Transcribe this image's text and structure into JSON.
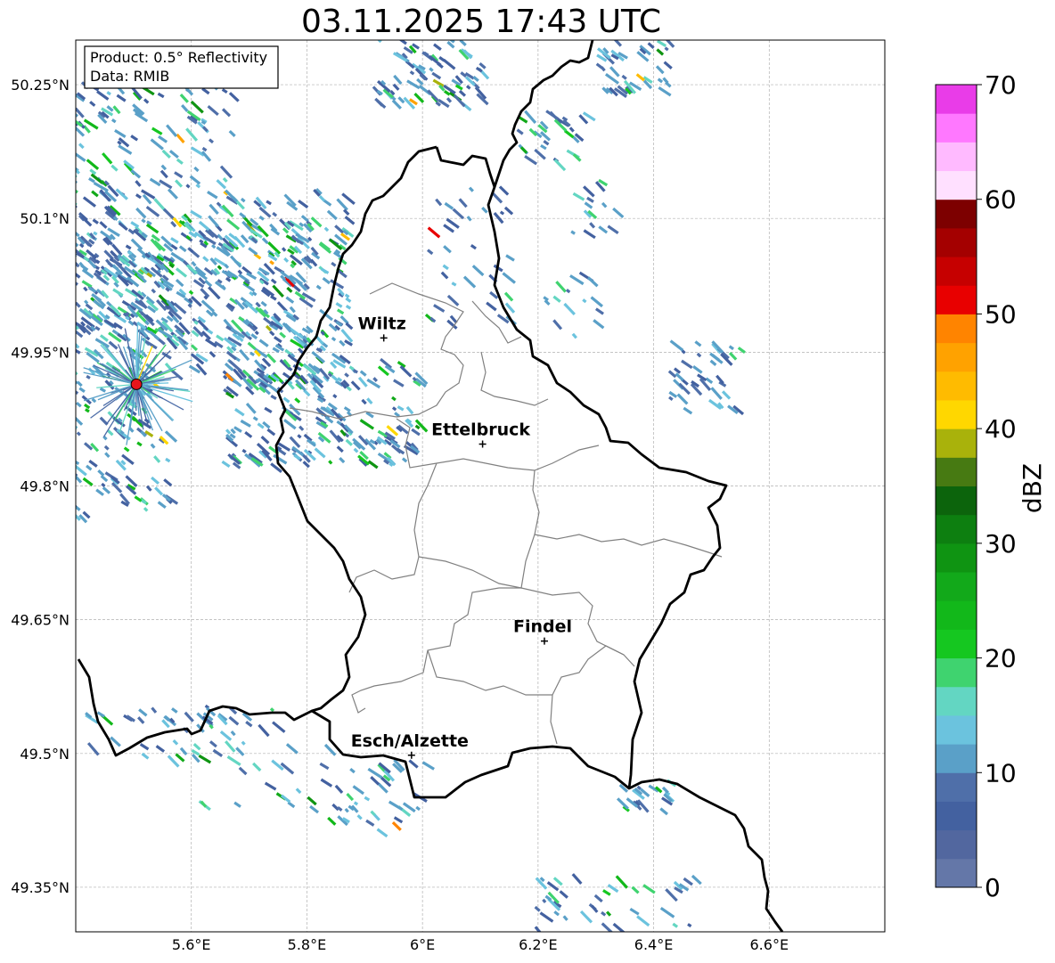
{
  "title": "03.11.2025 17:43 UTC",
  "info_box": {
    "product": "Product: 0.5° Reflectivity",
    "data": "Data: RMIB"
  },
  "map": {
    "lon_ticks": [
      "5.6°E",
      "5.8°E",
      "6°E",
      "6.2°E",
      "6.4°E",
      "6.6°E"
    ],
    "lat_ticks": [
      "50.25°N",
      "50.1°N",
      "49.95°N",
      "49.8°N",
      "49.65°N",
      "49.5°N",
      "49.35°N"
    ],
    "extent": {
      "lon": [
        5.4,
        6.8
      ],
      "lat": [
        49.3,
        50.3
      ]
    },
    "radar_site": {
      "lon": 5.505,
      "lat": 49.914
    },
    "cities": [
      {
        "name": "Wiltz",
        "lon": 5.933,
        "lat": 49.966
      },
      {
        "name": "Ettelbruck",
        "lon": 6.104,
        "lat": 49.847
      },
      {
        "name": "Findel",
        "lon": 6.211,
        "lat": 49.626
      },
      {
        "name": "Esch/Alzette",
        "lon": 5.981,
        "lat": 49.498
      }
    ]
  },
  "colorbar": {
    "label": "dBZ",
    "ticks": [
      "0",
      "10",
      "20",
      "30",
      "40",
      "50",
      "60",
      "70"
    ],
    "colors": [
      "#6477a8",
      "#52679f",
      "#4361a0",
      "#4f6fa9",
      "#5aa0c8",
      "#6bc3de",
      "#63d6c2",
      "#3fd36f",
      "#15c720",
      "#12b81a",
      "#12a91a",
      "#0f9412",
      "#0d7f10",
      "#0c640c",
      "#477a12",
      "#a9b20b",
      "#ffd700",
      "#ffbb00",
      "#ffa200",
      "#ff8400",
      "#e80000",
      "#c60000",
      "#a40000",
      "#7d0000",
      "#ffe0ff",
      "#ffbaff",
      "#ff78ff",
      "#e93ce8"
    ]
  }
}
